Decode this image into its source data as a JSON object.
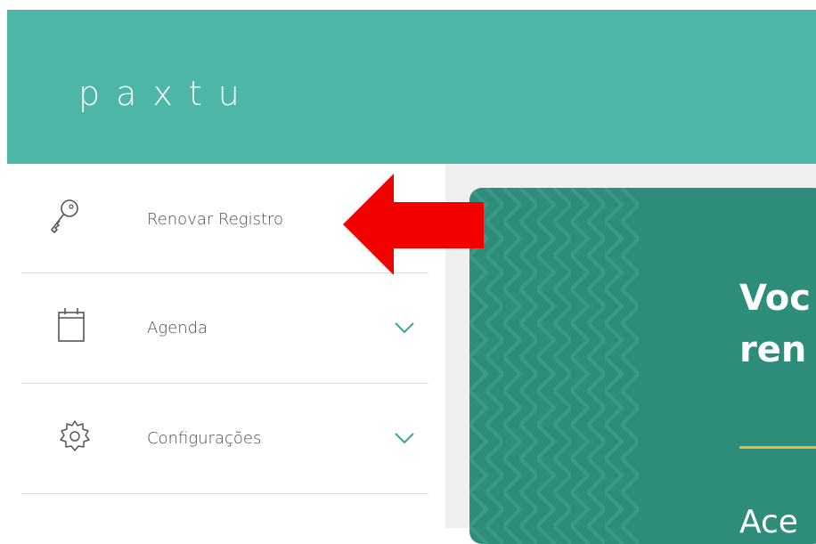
{
  "header": {
    "logo_text": "paxtu"
  },
  "sidebar": {
    "items": [
      {
        "label": "Renovar  Registro",
        "icon": "key-icon",
        "has_chevron": false
      },
      {
        "label": "Agenda",
        "icon": "calendar-icon",
        "has_chevron": true
      },
      {
        "label": "Configurações",
        "icon": "gear-icon",
        "has_chevron": true
      }
    ]
  },
  "promo": {
    "title_line1": "Voc",
    "title_line2": "ren",
    "subtitle_partial": "Ace"
  },
  "annotation": {
    "arrow": "red-arrow-pointing-left",
    "color": "#f20000"
  },
  "colors": {
    "header": "#4db6a7",
    "promo_bg": "#2e8c7b",
    "chevron": "#3aa597",
    "accent_rule": "#f0b43c",
    "main_bg": "#efefef"
  }
}
